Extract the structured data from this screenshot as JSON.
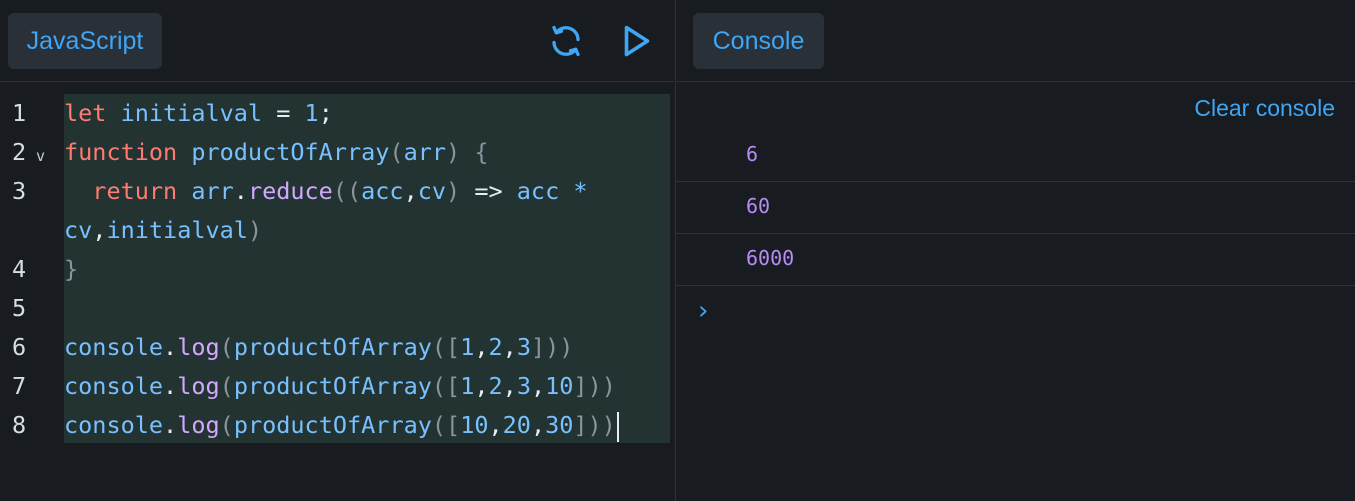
{
  "editor": {
    "tab_label": "JavaScript",
    "refresh_icon": "refresh-icon",
    "run_icon": "play-icon",
    "lines": [
      {
        "num": "1",
        "fold": ""
      },
      {
        "num": "2",
        "fold": "v"
      },
      {
        "num": "3",
        "fold": ""
      },
      {
        "num": "4",
        "fold": ""
      },
      {
        "num": "5",
        "fold": ""
      },
      {
        "num": "6",
        "fold": ""
      },
      {
        "num": "7",
        "fold": ""
      },
      {
        "num": "8",
        "fold": ""
      }
    ],
    "tokens": {
      "l1": [
        "let",
        " initialval",
        " = ",
        "1",
        ";"
      ],
      "l2": [
        "function",
        " productOfArray",
        "(",
        "arr",
        ")",
        " {"
      ],
      "l3a": [
        "  return",
        " arr",
        ".",
        "reduce",
        "((",
        "acc",
        ",",
        "cv",
        ")",
        " => ",
        "acc",
        " *"
      ],
      "l3b": [
        "cv",
        ",",
        "initialval",
        ")"
      ],
      "l4": [
        "}"
      ],
      "l6": [
        "console",
        ".",
        "log",
        "(",
        "productOfArray",
        "([",
        "1",
        ",",
        "2",
        ",",
        "3",
        "]))"
      ],
      "l7": [
        "console",
        ".",
        "log",
        "(",
        "productOfArray",
        "([",
        "1",
        ",",
        "2",
        ",",
        "3",
        ",",
        "10",
        "]))"
      ],
      "l8": [
        "console",
        ".",
        "log",
        "(",
        "productOfArray",
        "([",
        "10",
        ",",
        "20",
        ",",
        "30",
        "]))"
      ]
    }
  },
  "console": {
    "tab_label": "Console",
    "clear_label": "Clear console",
    "logs": [
      "6",
      "60",
      "6000"
    ],
    "prompt": "›"
  },
  "colors": {
    "accent": "#3ea6f5",
    "keyword": "#ff7b72",
    "identifier": "#79c0ff",
    "function": "#d2a8ff",
    "log_value": "#b58cf5",
    "background": "#181c21"
  }
}
